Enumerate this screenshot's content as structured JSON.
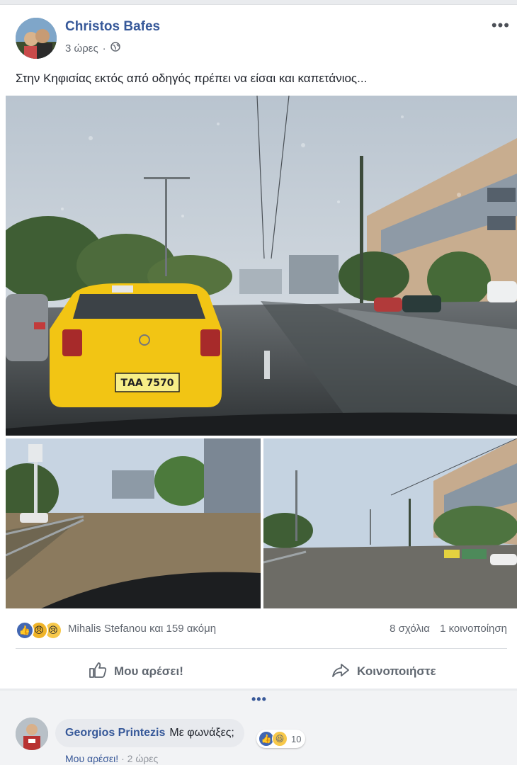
{
  "post": {
    "author": "Christos Bafes",
    "time": "3 ώρες",
    "separator": "·",
    "privacy_icon": "globe-icon",
    "more_label": "•••",
    "text": "Στην Κηφισίας εκτός από οδηγός πρέπει να είσαι και καπετάνιος...",
    "taxi_plate": "ΤΑΑ 7570"
  },
  "reactions": {
    "icons": [
      "like-icon",
      "angry-icon",
      "sad-icon"
    ],
    "names": "Mihalis Stefanou και 159 ακόμη",
    "comments": "8 σχόλια",
    "shares": "1 κοινοποίηση"
  },
  "actions": {
    "like": "Μου αρέσει!",
    "share": "Κοινοποιήστε"
  },
  "comments": {
    "more_dots": "•••",
    "items": [
      {
        "author": "Georgios Printezis",
        "text": "Με φωνάξες;",
        "reaction_count": "10",
        "like_label": "Μου αρέσει!",
        "separator": "·",
        "time": "2 ώρες"
      }
    ]
  },
  "colors": {
    "link_blue": "#365899",
    "like_blue": "#4267b2",
    "taxi_yellow": "#f2c514",
    "feed_bg": "#e9ebee"
  }
}
